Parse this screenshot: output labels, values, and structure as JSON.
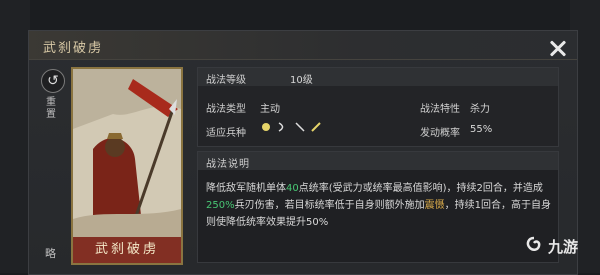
{
  "dialog": {
    "title": "武刹破虏",
    "close": "✕"
  },
  "side": {
    "reset_icon": "↺",
    "reset_label": "重置",
    "slight_label": "略"
  },
  "card": {
    "name": "武刹破虏"
  },
  "info": {
    "level_label": "战法等级",
    "level_value": "10级",
    "type_label": "战法类型",
    "type_value": "主动",
    "trait_label": "战法特性",
    "trait_value": "杀力",
    "troop_label": "适应兵种",
    "rate_label": "发动概率",
    "rate_value": "55%"
  },
  "desc": {
    "title": "战法说明",
    "p1": "降低敌军随机单体",
    "p2": "40",
    "p3": "点统率(受武力或统率最高值影响)，持续2回合，并造成",
    "p4": "250%",
    "p5": "兵刃伤害，若目标统率低于自身则额外施加",
    "p6": "震慑",
    "p7": "，持续1回合，高于自身则使降低统率效果提升50%"
  },
  "watermark": {
    "text": "九游",
    "icon": "swirl-icon"
  },
  "colors": {
    "accent_green": "#48c774",
    "accent_red": "#d9473a",
    "accent_gold": "#d6a84a"
  }
}
